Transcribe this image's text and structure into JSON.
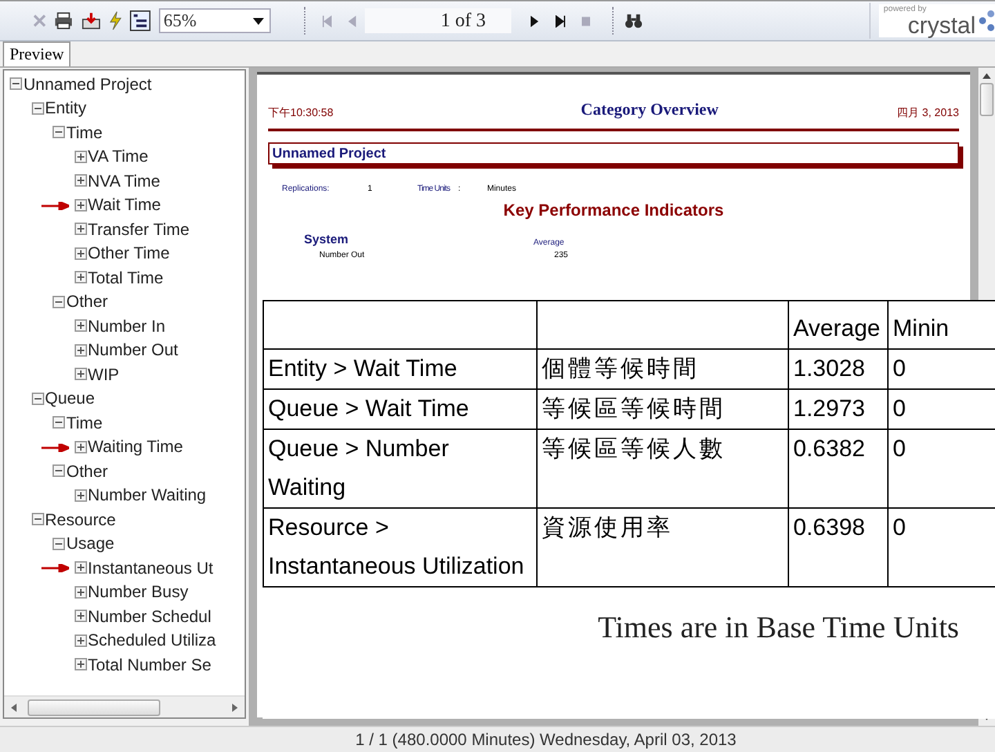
{
  "toolbar": {
    "zoom": "65%",
    "page": "1 of 3",
    "brand_caption": "powered by",
    "brand": "crystal"
  },
  "tabs": [
    {
      "label": "Preview",
      "selected": true
    }
  ],
  "tree": [
    {
      "label": "Unnamed Project",
      "expanded": true,
      "children": [
        {
          "label": "Entity",
          "expanded": true,
          "children": [
            {
              "label": "Time",
              "expanded": true,
              "children": [
                {
                  "label": "VA Time",
                  "expanded": false,
                  "marked": false
                },
                {
                  "label": "NVA Time",
                  "expanded": false,
                  "marked": false
                },
                {
                  "label": "Wait Time",
                  "expanded": false,
                  "marked": true
                },
                {
                  "label": "Transfer Time",
                  "expanded": false,
                  "marked": false
                },
                {
                  "label": "Other Time",
                  "expanded": false,
                  "marked": false
                },
                {
                  "label": "Total Time",
                  "expanded": false,
                  "marked": false
                }
              ]
            },
            {
              "label": "Other",
              "expanded": true,
              "children": [
                {
                  "label": "Number In",
                  "expanded": false,
                  "marked": false
                },
                {
                  "label": "Number Out",
                  "expanded": false,
                  "marked": false
                },
                {
                  "label": "WIP",
                  "expanded": false,
                  "marked": false
                }
              ]
            }
          ]
        },
        {
          "label": "Queue",
          "expanded": true,
          "children": [
            {
              "label": "Time",
              "expanded": true,
              "children": [
                {
                  "label": "Waiting Time",
                  "expanded": false,
                  "marked": true
                }
              ]
            },
            {
              "label": "Other",
              "expanded": true,
              "children": [
                {
                  "label": "Number Waiting",
                  "expanded": false,
                  "marked": false
                }
              ]
            }
          ]
        },
        {
          "label": "Resource",
          "expanded": true,
          "children": [
            {
              "label": "Usage",
              "expanded": true,
              "children": [
                {
                  "label": "Instantaneous Ut",
                  "expanded": false,
                  "marked": true
                },
                {
                  "label": "Number Busy",
                  "expanded": false,
                  "marked": false
                },
                {
                  "label": "Number Schedul",
                  "expanded": false,
                  "marked": false
                },
                {
                  "label": "Scheduled Utiliza",
                  "expanded": false,
                  "marked": false
                },
                {
                  "label": "Total Number Se",
                  "expanded": false,
                  "marked": false
                }
              ]
            }
          ]
        }
      ]
    }
  ],
  "report": {
    "time": "下午10:30:58",
    "title": "Category Overview",
    "date": "四月 3, 2013",
    "project": "Unnamed Project",
    "replications_label": "Replications:",
    "replications": "1",
    "time_units_label": "Time Units",
    "time_units_sep": ":",
    "time_units": "Minutes",
    "section_title": "Key Performance Indicators",
    "group": "System",
    "column": "Average",
    "row_label": "Number Out",
    "row_value": "235"
  },
  "overlay_table": {
    "columns": [
      "",
      "",
      "Average",
      "Minin"
    ],
    "rows": [
      [
        "Entity > Wait Time",
        "個體等候時間",
        "1.3028",
        "0"
      ],
      [
        "Queue > Wait Time",
        "等候區等候時間",
        "1.2973",
        "0"
      ],
      [
        "Queue > Number Waiting",
        "等候區等候人數",
        "0.6382",
        "0"
      ],
      [
        "Resource > Instantaneous Utilization",
        "資源使用率",
        "0.6398",
        "0"
      ]
    ],
    "note": "Times are in Base Time Units"
  },
  "status_bar": "1 / 1 (480.0000 Minutes) Wednesday, April 03, 2013"
}
